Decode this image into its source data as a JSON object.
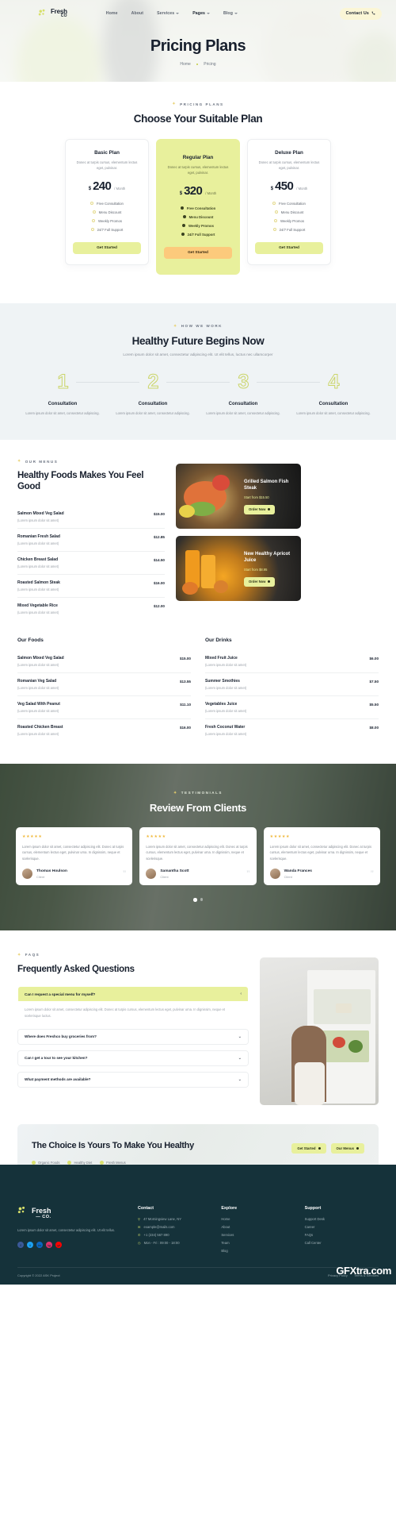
{
  "nav": {
    "logo": {
      "line1": "Fresh",
      "line2": "CO"
    },
    "links": [
      {
        "label": "Home",
        "caret": false
      },
      {
        "label": "About",
        "caret": false
      },
      {
        "label": "Services",
        "caret": true
      },
      {
        "label": "Pages",
        "caret": true
      },
      {
        "label": "Blog",
        "caret": true
      }
    ],
    "contact_label": "Contact Us",
    "phone_icon": "phone-icon"
  },
  "hero": {
    "title": "Pricing Plans",
    "crumb_home": "Home",
    "crumb_current": "Pricing"
  },
  "pricing": {
    "eyebrow": "PRICING PLANS",
    "title": "Choose Your Suitable Plan",
    "plans": [
      {
        "name": "Basic Plan",
        "desc": "Donec at turpis cursus, elementum lectus eget, pulvinar.",
        "currency": "$",
        "amount": "240",
        "period": "/ Month",
        "features": [
          "Free Consultation",
          "Menu Discount",
          "Weekly Promos",
          "24/7 Full Support"
        ],
        "cta": "Get Started",
        "featured": false
      },
      {
        "name": "Regular Plan",
        "desc": "Donec at turpis cursus, elementum lectus eget, pulvinar.",
        "currency": "$",
        "amount": "320",
        "period": "/ Month",
        "features": [
          "Free Consultation",
          "Menu Discount",
          "Weekly Promos",
          "24/7 Full Support"
        ],
        "cta": "Get Started",
        "featured": true
      },
      {
        "name": "Deluxe Plan",
        "desc": "Donec at turpis cursus, elementum lectus eget, pulvinar.",
        "currency": "$",
        "amount": "450",
        "period": "/ Month",
        "features": [
          "Free Consultation",
          "Menu Discount",
          "Weekly Promos",
          "24/7 Full Support"
        ],
        "cta": "Get Started",
        "featured": false
      }
    ]
  },
  "howwork": {
    "eyebrow": "HOW WE WORK",
    "title": "Healthy Future Begins Now",
    "subtitle": "Lorem ipsum dolor sit amet, consectetur adipiscing elit. Ut elit tellus, luctus nec ullamcorper",
    "steps": [
      {
        "num": "1",
        "title": "Consultation",
        "desc": "Lorem ipsum dolor sit amet, consectetur adipiscing."
      },
      {
        "num": "2",
        "title": "Consultation",
        "desc": "Lorem ipsum dolor sit amet, consectetur adipiscing."
      },
      {
        "num": "3",
        "title": "Consultation",
        "desc": "Lorem ipsum dolor sit amet, consectetur adipiscing."
      },
      {
        "num": "4",
        "title": "Consultation",
        "desc": "Lorem ipsum dolor sit amet, consectetur adipiscing."
      }
    ]
  },
  "menus": {
    "eyebrow": "OUR MENUS",
    "title": "Healthy Foods Makes You Feel Good",
    "items": [
      {
        "name": "Salmon Mixed Veg Salad",
        "sub": "(Lorem ipsum dolor sit amet)",
        "price": "$15.00"
      },
      {
        "name": "Romanian Fresh Salad",
        "sub": "(Lorem ipsum dolor sit amet)",
        "price": "$12.85"
      },
      {
        "name": "Chicken Breast Salad",
        "sub": "(Lorem ipsum dolor sit amet)",
        "price": "$14.50"
      },
      {
        "name": "Roasted Salmon Steak",
        "sub": "(Lorem ipsum dolor sit amet)",
        "price": "$16.00"
      },
      {
        "name": "Mixed Vegetable Rice",
        "sub": "(Lorem ipsum dolor sit amet)",
        "price": "$12.00"
      }
    ],
    "promos": [
      {
        "title": "Grilled Salmon Fish Steak",
        "price": "Start from $15.50",
        "btn": "Order Now"
      },
      {
        "title": "New Healthy Apricot Juice",
        "price": "Start from $8.95",
        "btn": "Order Now"
      }
    ]
  },
  "foods": {
    "head": "Our Foods",
    "items": [
      {
        "name": "Salmon Mixed Veg Salad",
        "sub": "(Lorem ipsum dolor sit amet)",
        "price": "$15.00"
      },
      {
        "name": "Romanian Veg Salad",
        "sub": "(Lorem ipsum dolor sit amet)",
        "price": "$13.55"
      },
      {
        "name": "Veg Salad With Peanut",
        "sub": "(Lorem ipsum dolor sit amet)",
        "price": "$11.10"
      },
      {
        "name": "Roasted Chicken Breast",
        "sub": "(Lorem ipsum dolor sit amet)",
        "price": "$16.00"
      }
    ]
  },
  "drinks": {
    "head": "Our Drinks",
    "items": [
      {
        "name": "Mixed Fruit Juice",
        "sub": "(Lorem ipsum dolor sit amet)",
        "price": "$6.00"
      },
      {
        "name": "Summer Smothies",
        "sub": "(Lorem ipsum dolor sit amet)",
        "price": "$7.50"
      },
      {
        "name": "Vegetables Juice",
        "sub": "(Lorem ipsum dolor sit amet)",
        "price": "$5.50"
      },
      {
        "name": "Fresh Coconut Water",
        "sub": "(Lorem ipsum dolor sit amet)",
        "price": "$8.00"
      }
    ]
  },
  "testimonials": {
    "eyebrow": "TESTIMONIALS",
    "title": "Review From Clients",
    "cards": [
      {
        "stars": "★★★★★",
        "quote": "Lorem ipsum dolor sit amet, consectetur adipiscing elit. Donec at turpis cursus, elementum lectus eget, pulvinar urna. In dignissim, neque et scelerisque.",
        "name": "Thomas Houlson",
        "role": "Client"
      },
      {
        "stars": "★★★★★",
        "quote": "Lorem ipsum dolor sit amet, consectetur adipiscing elit. Donec at turpis cursus, elementum lectus eget, pulvinar urna. In dignissim, neque et scelerisque.",
        "name": "Samantha Scott",
        "role": "Client"
      },
      {
        "stars": "★★★★★",
        "quote": "Lorem ipsum dolor sit amet, consectetur adipiscing elit. Donec at turpis cursus, elementum lectus eget, pulvinar urna. In dignissim, neque et scelerisque.",
        "name": "Wanda Frances",
        "role": "Client"
      }
    ]
  },
  "faq": {
    "eyebrow": "FAQS",
    "title": "Frequently Asked Questions",
    "items": [
      {
        "q": "Can I request a special menu for myself?",
        "a": "Lorem ipsum dolor sit amet, consectetur adipiscing elit. Donec at turpis cursus, elementum lectus eget, pulvinar urna. In dignissim, neque et scelerisque luctus.",
        "open": true
      },
      {
        "q": "Where does Freshco buy groceries from?",
        "a": "",
        "open": false
      },
      {
        "q": "Can I get a tour to see your kitchen?",
        "a": "",
        "open": false
      },
      {
        "q": "What payment methods are available?",
        "a": "",
        "open": false
      }
    ]
  },
  "ctaband": {
    "title": "The Choice Is Yours To Make You Healthy",
    "tags": [
      "Organic Foods",
      "Healthy Diet",
      "Fresh Menus"
    ],
    "buttons": [
      "Get Started",
      "Our Menus"
    ]
  },
  "footer": {
    "logo": {
      "line1": "Fresh",
      "line2": "— CO."
    },
    "desc": "Lorem ipsum dolor sit amet, consectetur adipiscing elit. Ut elit tellus.",
    "socials": [
      "f",
      "t",
      "in",
      "ig",
      "yt"
    ],
    "contact": {
      "head": "Contact",
      "items": [
        {
          "icon": "location-icon",
          "text": "47 Morningview Lane, NY"
        },
        {
          "icon": "mail-icon",
          "text": "example@mails.com"
        },
        {
          "icon": "phone-icon",
          "text": "+1 (234) 567 890"
        },
        {
          "icon": "clock-icon",
          "text": "Mon - Fri : 09:00 - 18:00"
        }
      ]
    },
    "explore": {
      "head": "Explore",
      "items": [
        "Home",
        "About",
        "Services",
        "Team",
        "Blog"
      ]
    },
    "support": {
      "head": "Support",
      "items": [
        "Support Desk",
        "Career",
        "FAQs",
        "Call Center"
      ]
    },
    "copyright": "Copyright © 2022 ASK Project",
    "legal": [
      "Privacy Policy",
      "Terms & Services"
    ]
  },
  "watermark": "GFXtra.com",
  "colors": {
    "accent_lime": "#e8f09c",
    "accent_orange": "#fcca7c",
    "dark": "#18202e",
    "footer_bg": "#15323a"
  }
}
